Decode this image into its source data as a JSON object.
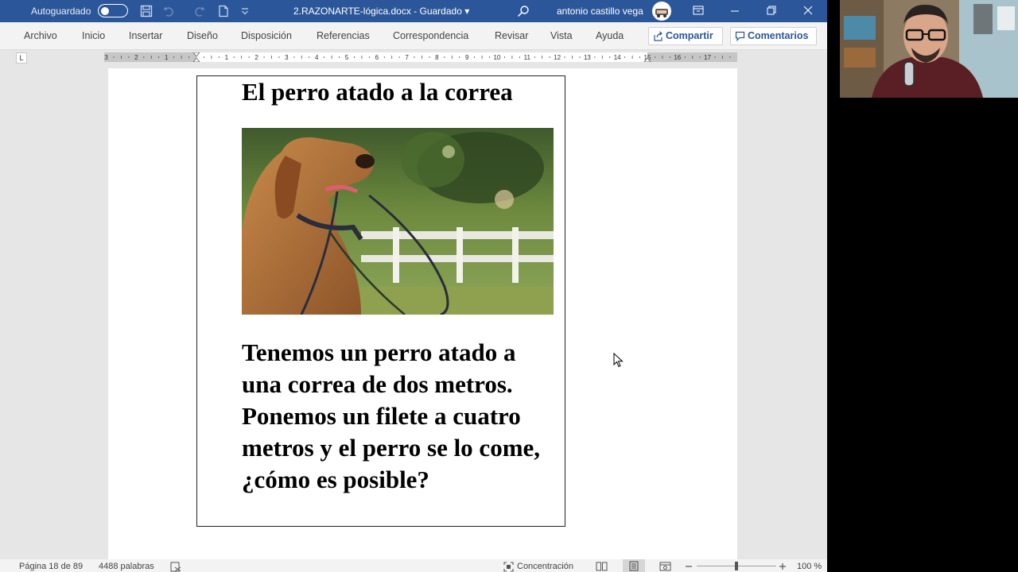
{
  "titlebar": {
    "autosave_label": "Autoguardado",
    "document_title": "2.RAZONARTE-lógica.docx  -  Guardado  ▾",
    "user_name": "antonio castillo vega",
    "icons": [
      "save-icon",
      "undo-icon",
      "redo-icon",
      "new-doc-icon",
      "customize-icon",
      "search-icon",
      "ribbon-display-icon",
      "minimize-icon",
      "restore-icon",
      "close-icon"
    ]
  },
  "ribbon": {
    "tabs": [
      "Archivo",
      "Inicio",
      "Insertar",
      "Diseño",
      "Disposición",
      "Referencias",
      "Correspondencia",
      "Revisar",
      "Vista",
      "Ayuda"
    ],
    "share_label": "Compartir",
    "comments_label": "Comentarios"
  },
  "ruler": {
    "tab_selector": "L",
    "labels": [
      "3",
      "2",
      "1",
      "1",
      "2",
      "3",
      "4",
      "5",
      "6",
      "7",
      "8",
      "9",
      "10",
      "11",
      "12",
      "13",
      "14",
      "15",
      "16",
      "17"
    ]
  },
  "document": {
    "heading": "El perro atado a la correa",
    "paragraph": "Tenemos un perro atado a una correa de dos metros. Ponemos un filete a cuatro metros y el perro se lo come, ¿cómo es posible?"
  },
  "statusbar": {
    "page_info": "Página 18 de 89",
    "word_count": "4488 palabras",
    "focus_label": "Concentración",
    "zoom": "100 %",
    "zoom_percent": 100
  },
  "colors": {
    "titlebar": "#2b579a",
    "ribbon": "#f3f3f3",
    "canvas": "#e6e6e6",
    "accent": "#2b579a"
  }
}
